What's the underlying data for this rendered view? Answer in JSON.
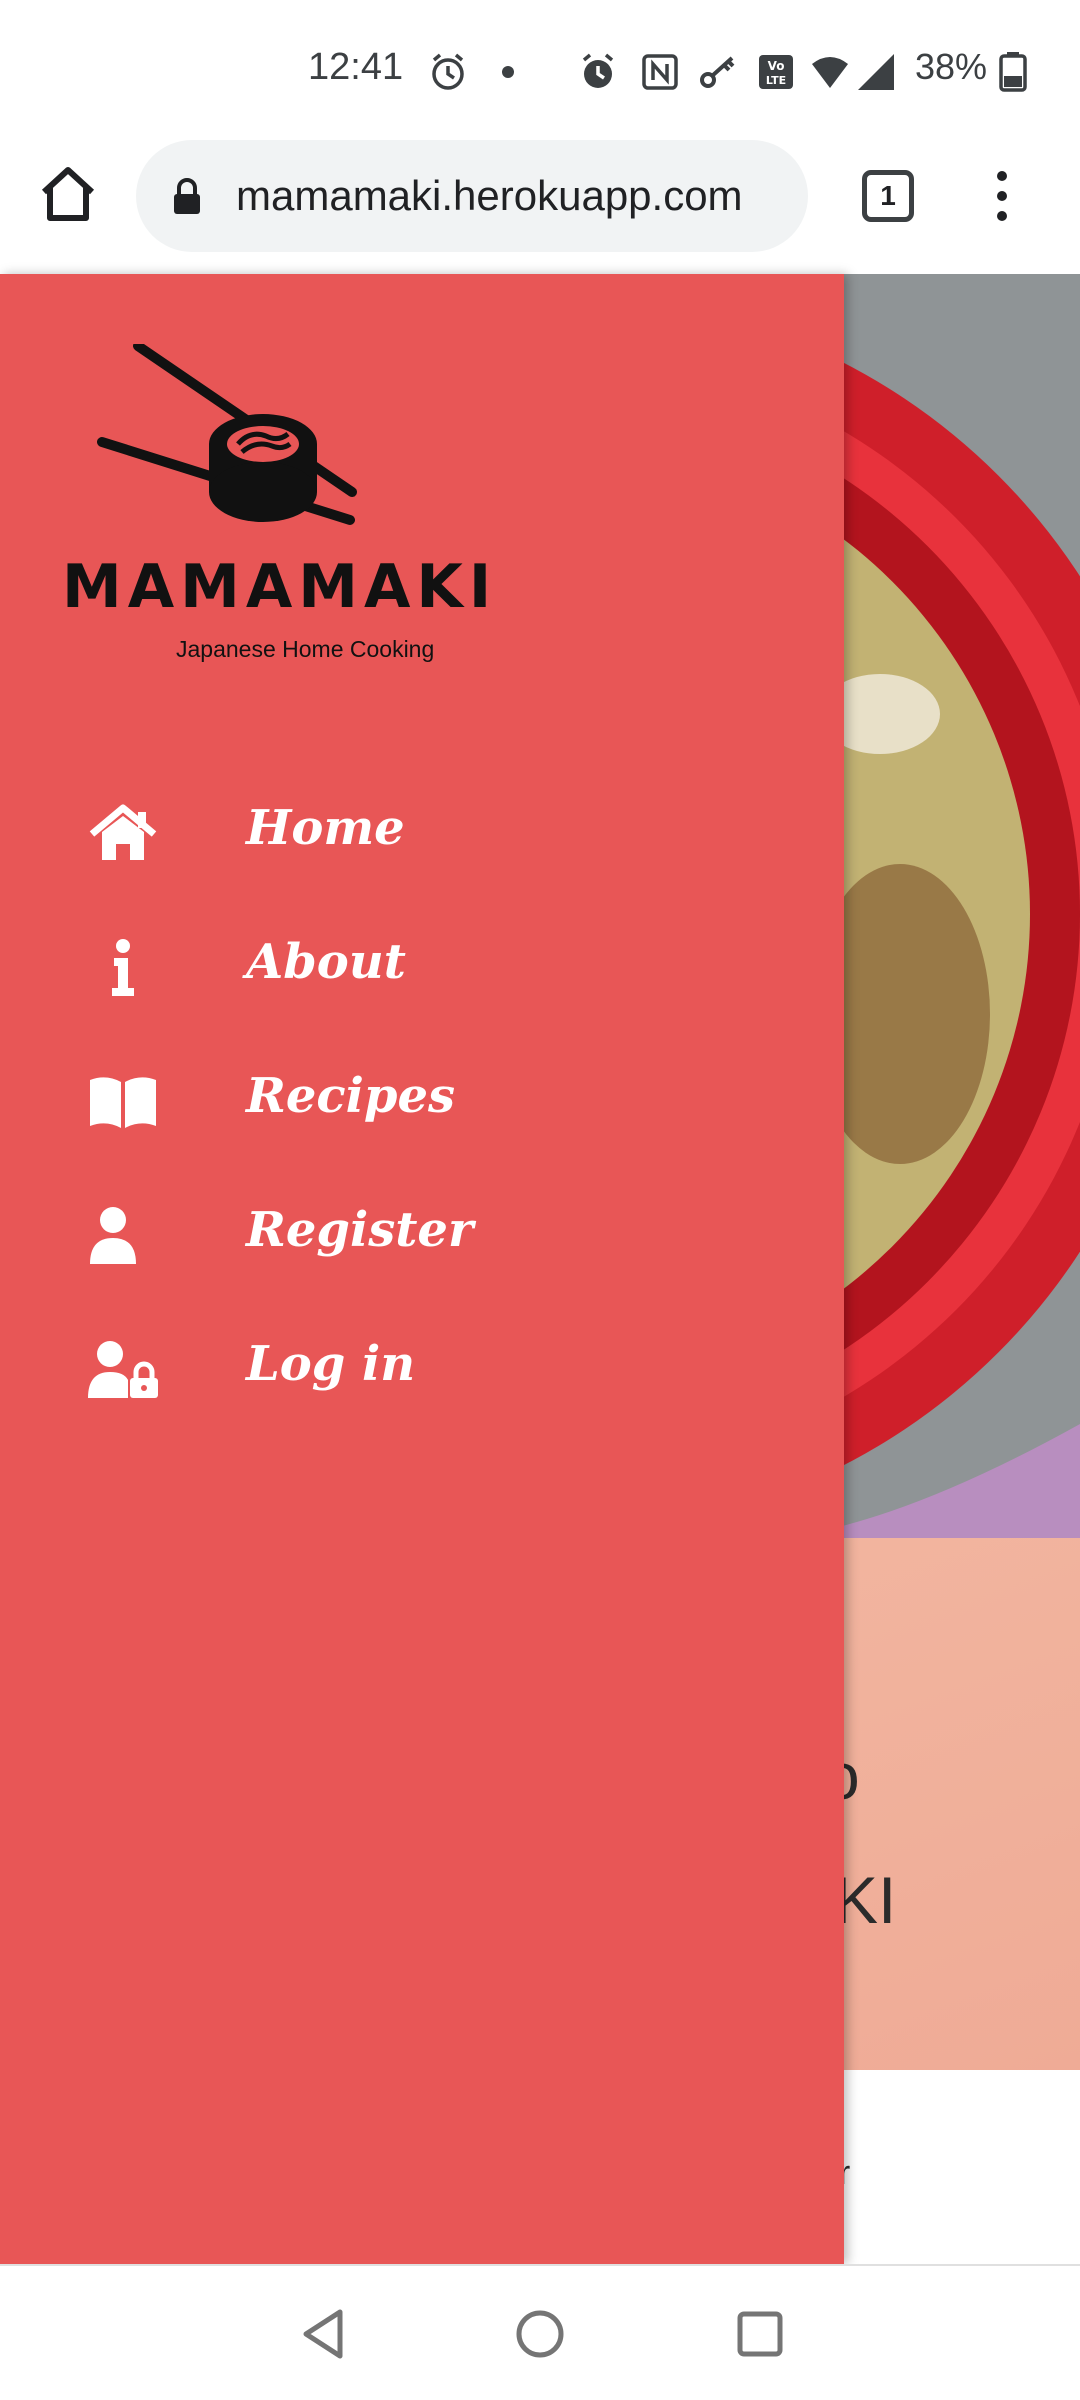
{
  "status_bar": {
    "time": "12:41",
    "battery": "38%",
    "icons": [
      "alarm-icon",
      "dot-icon",
      "alarm-icon",
      "nfc-icon",
      "key-icon",
      "volte-icon",
      "wifi-icon",
      "signal-icon",
      "battery-icon"
    ]
  },
  "browser": {
    "url": "mamamaki.herokuapp.com",
    "tab_count": "1"
  },
  "drawer": {
    "brand": "MAMAMAKI",
    "tagline": "Japanese Home Cooking",
    "accent": "#e85656",
    "items": [
      {
        "label": "Home",
        "icon": "home-icon"
      },
      {
        "label": "About",
        "icon": "info-icon"
      },
      {
        "label": "Recipes",
        "icon": "book-icon"
      },
      {
        "label": "Register",
        "icon": "user-icon"
      },
      {
        "label": "Log in",
        "icon": "user-lock-icon"
      }
    ]
  },
  "page_behind": {
    "line1": "so",
    "line2": "AKI",
    "line3": "er"
  }
}
